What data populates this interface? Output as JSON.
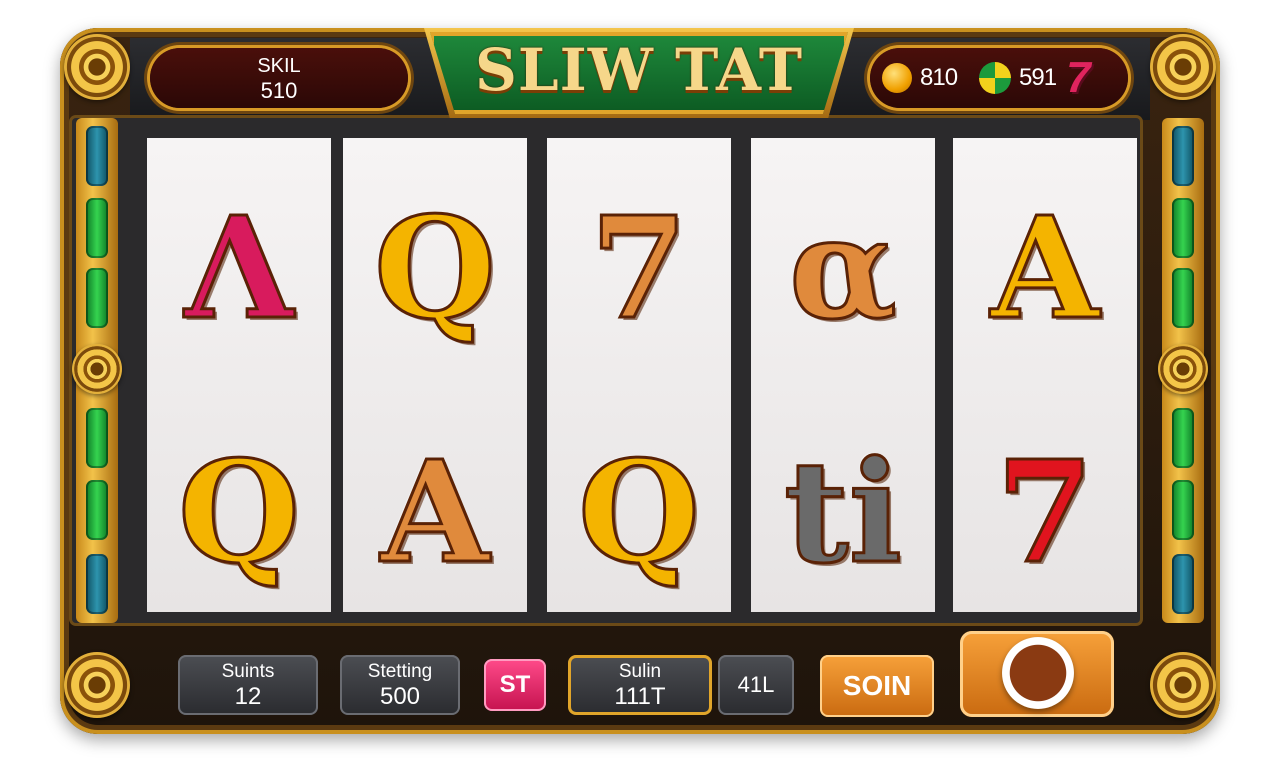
{
  "game": {
    "title": "SLIW TAT",
    "skill_panel": {
      "label": "SKIL",
      "value": "510"
    },
    "coins_panel": {
      "coin_count": "810",
      "ball_count": "591",
      "seven_symbol": "7"
    }
  },
  "reels": [
    {
      "symbols": [
        {
          "char": "Λ",
          "color": "#d81b5d"
        },
        {
          "char": "Q",
          "color": "#f4b400"
        }
      ]
    },
    {
      "symbols": [
        {
          "char": "Q",
          "color": "#f4b400"
        },
        {
          "char": "A",
          "color": "#e08a3c"
        }
      ]
    },
    {
      "symbols": [
        {
          "char": "7",
          "color": "#e08a3c"
        },
        {
          "char": "Q",
          "color": "#f4b400"
        }
      ]
    },
    {
      "symbols": [
        {
          "char": "α",
          "color": "#e08a3c"
        },
        {
          "char": "ti",
          "color": "#6a6a6a"
        }
      ]
    },
    {
      "symbols": [
        {
          "char": "A",
          "color": "#f4b400"
        },
        {
          "char": "7",
          "color": "#e0141e"
        }
      ]
    }
  ],
  "controls": {
    "points": {
      "label": "Suints",
      "value": "12"
    },
    "starting": {
      "label": "Stetting",
      "value": "500"
    },
    "st_button": "ST",
    "sulin": {
      "label": "Sulin",
      "value": "111T"
    },
    "lines": "41L",
    "soin_button": "SOIN",
    "spin_button_icon": "spin-icon"
  },
  "colors": {
    "frame_gold": "#d89a26",
    "banner_green": "#1f8a3c",
    "accent_orange": "#f7a13a",
    "accent_pink": "#e0245e"
  }
}
